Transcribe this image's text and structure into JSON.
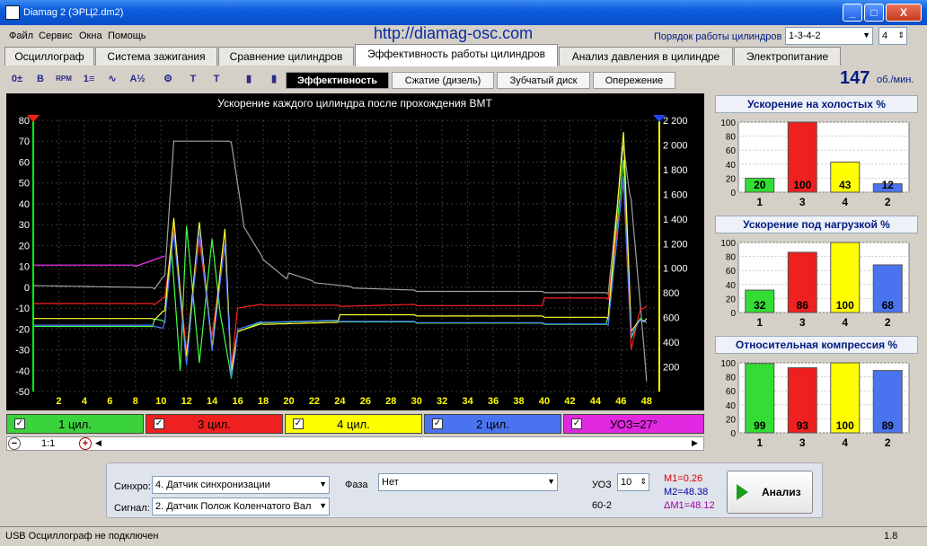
{
  "window": {
    "title": "Diamag 2 (ЭРЦ2.dm2)",
    "minimize": "_",
    "maximize": "□",
    "close": "X"
  },
  "menu": [
    "Файл",
    "Сервис",
    "Окна",
    "Помощь"
  ],
  "site_url": "http://diamag-osc.com",
  "order": {
    "label": "Порядок работы цилиндров",
    "value": "1-3-4-2",
    "count": "4"
  },
  "tabs": [
    "Осциллограф",
    "Система зажигания",
    "Сравнение цилиндров",
    "Эффективность работы цилиндров",
    "Анализ давления в цилиндре",
    "Электропитание"
  ],
  "active_tab": 3,
  "toolbar_icons": [
    {
      "name": "zero-adjust-icon",
      "glyph": "0±"
    },
    {
      "name": "bold-b-icon",
      "glyph": "B"
    },
    {
      "name": "rpm-gauge-icon",
      "glyph": "RPM"
    },
    {
      "name": "sort-numbers-icon",
      "glyph": "1≡"
    },
    {
      "name": "line-graph-icon",
      "glyph": "∿"
    },
    {
      "name": "fraction-icon",
      "glyph": "A½"
    },
    {
      "name": "cylinder-icon",
      "glyph": "⚙"
    },
    {
      "name": "sequence-1234-icon",
      "glyph": "T"
    },
    {
      "name": "marker-icon",
      "glyph": "T"
    },
    {
      "name": "bar-chart-icon",
      "glyph": "▮"
    },
    {
      "name": "color-bar-icon",
      "glyph": "▮"
    }
  ],
  "subtabs": [
    "Эффективность",
    "Сжатие (дизель)",
    "Зубчатый диск",
    "Опережение"
  ],
  "rpm": {
    "value": "147",
    "unit": "об./мин."
  },
  "chart_data": {
    "type": "line",
    "title": "Ускорение каждого цилиндра после прохождения ВМТ",
    "xlim": [
      0,
      49
    ],
    "ylim": [
      -50,
      80
    ],
    "ylim_right": [
      0,
      2200
    ],
    "x_ticks": [
      "2",
      "4",
      "6",
      "8",
      "10",
      "12",
      "14",
      "16",
      "18",
      "20",
      "22",
      "24",
      "26",
      "28",
      "30",
      "32",
      "34",
      "36",
      "38",
      "40",
      "42",
      "44",
      "46",
      "48"
    ],
    "y_ticks": [
      "80",
      "70",
      "60",
      "50",
      "40",
      "30",
      "20",
      "10",
      "0",
      "-10",
      "-20",
      "-30",
      "-40",
      "-50"
    ],
    "y_right_ticks": [
      "2 200",
      "2 000",
      "1 800",
      "1 600",
      "1 400",
      "1 200",
      "1 000",
      "800",
      "600",
      "400",
      "200"
    ],
    "grid": true,
    "series": [
      {
        "name": "1 цил.",
        "color": "#44ff44",
        "x": [
          0,
          9.5,
          10.3,
          10.8,
          11.5,
          12,
          13,
          14,
          14.8,
          15.5,
          16,
          18,
          24,
          30,
          40,
          45,
          46.2,
          46.8,
          47.5,
          48
        ],
        "y": [
          -17,
          -17,
          -18,
          20,
          -40,
          30,
          -35,
          25,
          -20,
          -45,
          -22,
          -17,
          -16,
          -16,
          -16,
          -16,
          60,
          -25,
          -15,
          -17
        ]
      },
      {
        "name": "3 цил.",
        "color": "#ff2222",
        "x": [
          0,
          9.5,
          10.3,
          11,
          12,
          13,
          14,
          15,
          15.5,
          16,
          18,
          24,
          30,
          40,
          45,
          46.2,
          46.8,
          47.5,
          48
        ],
        "y": [
          -9,
          -9,
          -5,
          30,
          -30,
          25,
          -25,
          20,
          -40,
          -10,
          -8,
          -8,
          -7,
          -7,
          -7,
          50,
          -30,
          -10,
          -9
        ]
      },
      {
        "name": "4 цил.",
        "color": "#ffff33",
        "x": [
          0,
          9.5,
          10.3,
          11,
          12,
          13,
          14,
          15,
          15.5,
          16,
          18,
          24,
          30,
          40,
          45,
          46.2,
          46.8,
          47.5,
          48
        ],
        "y": [
          -15,
          -15,
          -10,
          35,
          -35,
          30,
          -30,
          28,
          -40,
          -20,
          -16,
          -15,
          -15,
          -15,
          -15,
          75,
          -20,
          -14,
          -15
        ]
      },
      {
        "name": "2 цил.",
        "color": "#4d7bff",
        "x": [
          0,
          9.5,
          10.3,
          11,
          12,
          13,
          14,
          15,
          15.5,
          16,
          18,
          24,
          30,
          40,
          45,
          46.2,
          46.8,
          47.5,
          48
        ],
        "y": [
          -17,
          -17,
          -18,
          25,
          -38,
          28,
          -30,
          22,
          -42,
          -22,
          -18,
          -17,
          -17,
          -17,
          -17,
          55,
          -25,
          -17,
          -17
        ]
      },
      {
        "name": "rpm",
        "color": "#a0a0a0",
        "x": [
          0,
          9.5,
          10.3,
          11,
          15.5,
          16.5,
          18,
          20,
          22,
          25,
          30,
          40,
          45,
          46.2,
          46.8,
          48
        ],
        "y": [
          -1,
          -2,
          5,
          70,
          70,
          30,
          15,
          5,
          1,
          -1,
          -2,
          -2,
          -2,
          70,
          40,
          -45
        ]
      },
      {
        "name": "УОЗ=27°",
        "color": "#ff33ff",
        "x": [
          0,
          8,
          10.3
        ],
        "y": [
          10,
          10,
          15
        ]
      }
    ]
  },
  "legend": [
    {
      "label": "1 цил.",
      "color": "#3bd33b",
      "check": "✓"
    },
    {
      "label": "3 цил.",
      "color": "#ee2020",
      "check": "✓"
    },
    {
      "label": "4 цил.",
      "color": "#ffff00",
      "check": "✓"
    },
    {
      "label": "2 цил.",
      "color": "#4a73f0",
      "check": "✓"
    },
    {
      "label": "УОЗ=27°",
      "color": "#e028e0",
      "check": "✓"
    }
  ],
  "zoom": {
    "minus": "−",
    "ratio": "1:1",
    "plus": "+"
  },
  "bar_panels": [
    {
      "title": "Ускорение на холостых %",
      "categories": [
        "1",
        "3",
        "4",
        "2"
      ],
      "values": [
        20,
        100,
        43,
        12
      ]
    },
    {
      "title": "Ускорение под нагрузкой %",
      "categories": [
        "1",
        "3",
        "4",
        "2"
      ],
      "values": [
        32,
        86,
        100,
        68
      ]
    },
    {
      "title": "Относительная компрессия %",
      "categories": [
        "1",
        "3",
        "4",
        "2"
      ],
      "values": [
        99,
        93,
        100,
        89
      ]
    }
  ],
  "bar_colors": [
    "#33dd33",
    "#ee2020",
    "#ffff00",
    "#4a73f0"
  ],
  "bar_yticks": [
    "100",
    "80",
    "60",
    "40",
    "20",
    "0"
  ],
  "bottom": {
    "sync_label": "Синхро:",
    "sync_value": "4.  Датчик синхронизации",
    "signal_label": "Сигнал:",
    "signal_value": "2.  Датчик Полож Коленчатого Вал",
    "phase_label": "Фаза",
    "phase_value": "Нет",
    "uoz_label": "УОЗ",
    "uoz_value": "10",
    "teeth": "60-2",
    "m1": "M1=0.26",
    "m2": "M2=48.38",
    "dm1": "ΔM1=48.12",
    "analyze": "Анализ"
  },
  "status": {
    "text": "USB Осциллограф не подключен",
    "version": "1.8"
  }
}
